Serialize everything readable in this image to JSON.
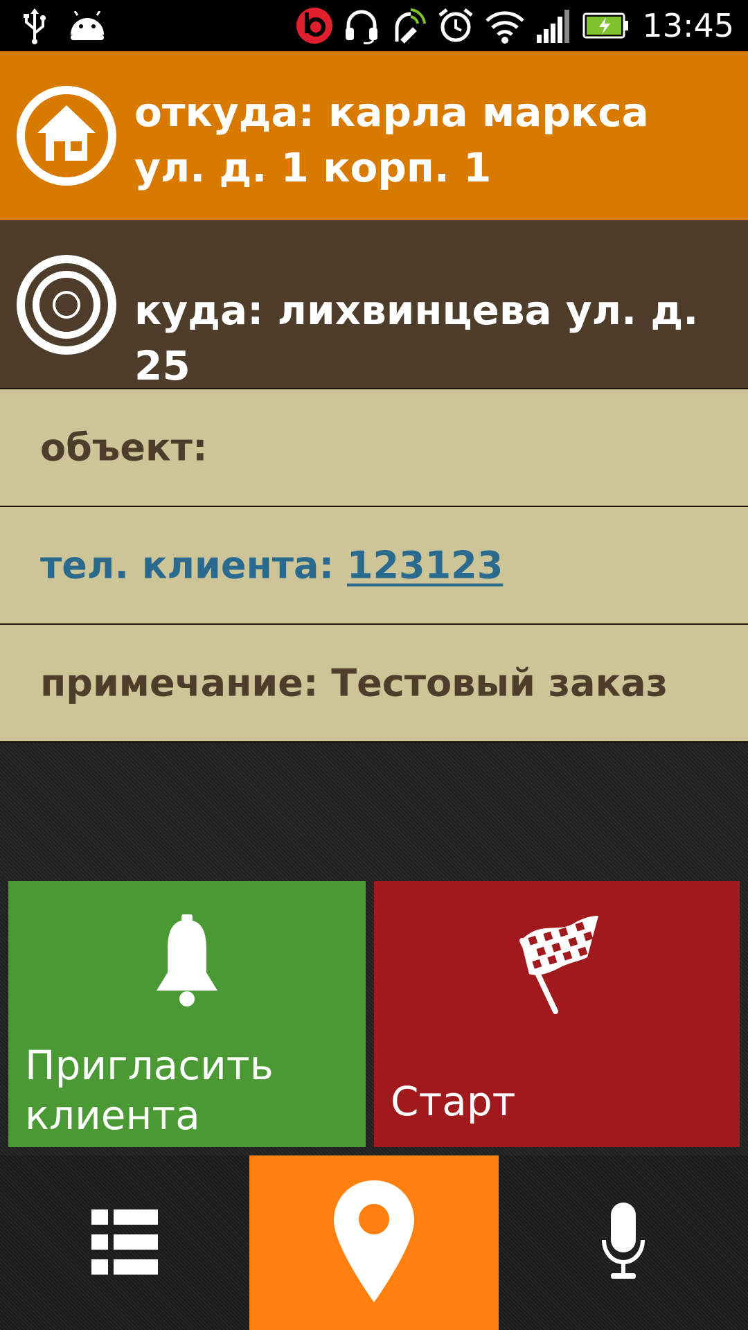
{
  "status_bar": {
    "time": "13:45",
    "icons": [
      "usb-icon",
      "android-icon",
      "beats-icon",
      "headset-icon",
      "sync-icon",
      "alarm-icon",
      "wifi-icon",
      "signal-icon",
      "battery-charging-icon"
    ]
  },
  "route": {
    "from_text": "откуда: карла маркса ул. д. 1 корп. 1",
    "to_text": "куда: лихвинцева ул. д. 25"
  },
  "details": {
    "object_label": "объект:",
    "phone_label": "тел. клиента: ",
    "phone_value": "123123",
    "note_label": "примечание: ",
    "note_value": "Тестовый заказ"
  },
  "actions": {
    "invite_label_line1": "Пригласить",
    "invite_label_line2": "клиента",
    "start_label": "Старт"
  },
  "nav": {
    "items": [
      {
        "icon": "list-icon",
        "active": false
      },
      {
        "icon": "map-pin-icon",
        "active": true
      },
      {
        "icon": "microphone-icon",
        "active": false
      }
    ]
  },
  "colors": {
    "from_bg": "#d87a00",
    "to_bg": "#4e3d2a",
    "info_bg": "#cdc498",
    "phone_color": "#2a6a8e",
    "invite_bg": "#4a9935",
    "start_bg": "#a0191d",
    "nav_active_bg": "#ff7f0f"
  }
}
